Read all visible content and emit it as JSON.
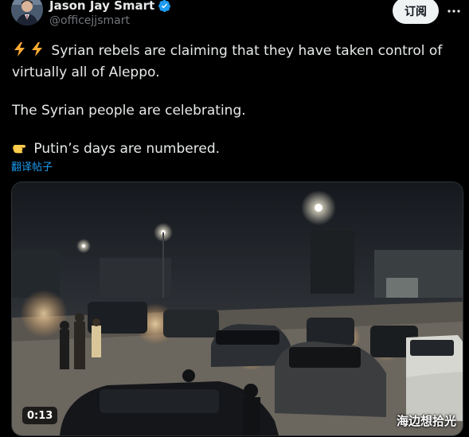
{
  "author": {
    "display_name": "Jason Jay Smart",
    "handle": "@officejjsmart",
    "verified": true,
    "avatar_icon": "user-avatar"
  },
  "actions": {
    "subscribe_label": "订阅",
    "more_icon": "more-horizontal-icon"
  },
  "tweet": {
    "line1_emoji": "⚡⚡",
    "line1_text": "Syrian rebels are claiming that they have taken control of virtually all of Aleppo.",
    "line2_text": "The Syrian people are celebrating.",
    "line3_emoji": "👉",
    "line3_text": "Putin’s days are numbered."
  },
  "translate_label": "翻译帖子",
  "video": {
    "duration": "0:13",
    "description_icon": "video-thumbnail"
  },
  "watermark": "海边想拾光",
  "colors": {
    "background": "#000000",
    "text": "#e7e9ea",
    "muted": "#71767b",
    "link": "#1d9bf0",
    "verified": "#1d9bf0",
    "button_bg": "#eff3f4"
  }
}
